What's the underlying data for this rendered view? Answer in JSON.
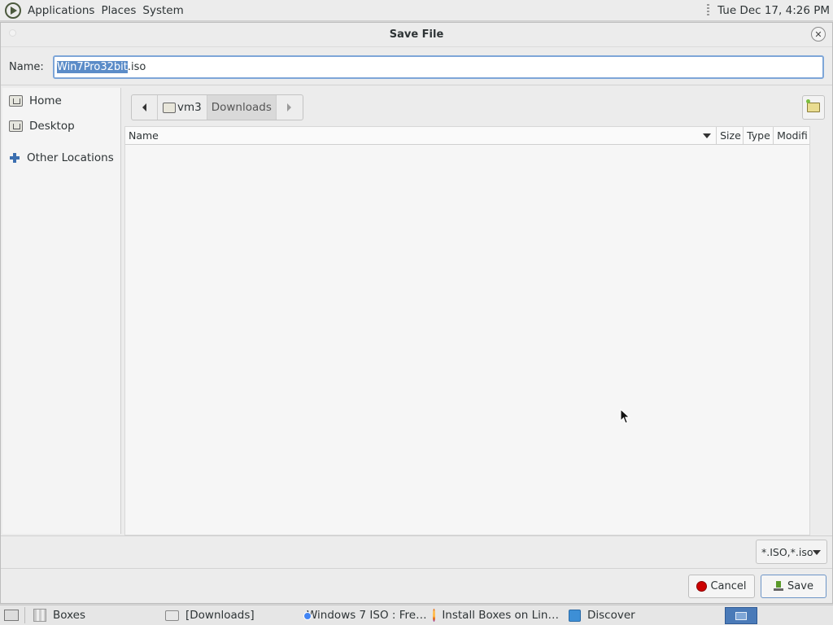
{
  "top_panel": {
    "menu": [
      "Applications",
      "Places",
      "System"
    ],
    "clock": "Tue Dec 17,  4:26 PM"
  },
  "dialog": {
    "title": "Save File",
    "name_label": "Name:",
    "filename_selected": "Win7Pro32bit",
    "filename_rest": ".iso",
    "sidebar": [
      {
        "label": "Home",
        "icon": "home-folder-icon"
      },
      {
        "label": "Desktop",
        "icon": "desktop-folder-icon"
      },
      {
        "label": "Other Locations",
        "icon": "plus-icon"
      }
    ],
    "pathbar": {
      "segments": [
        "vm3",
        "Downloads"
      ]
    },
    "columns": [
      "Name",
      "Size",
      "Type",
      "Modifi"
    ],
    "filter_label": "*.ISO,*.iso",
    "cancel_label": "Cancel",
    "save_label": "Save"
  },
  "taskbar": {
    "tasks": [
      {
        "label": "Boxes",
        "icon": "boxes-icon"
      },
      {
        "label": "[Downloads]",
        "icon": "folder-icon"
      },
      {
        "label": "Windows 7 ISO : Fre…",
        "icon": "chrome-icon"
      },
      {
        "label": "Install Boxes on Lin…",
        "icon": "firefox-icon"
      },
      {
        "label": "Discover",
        "icon": "discover-icon"
      }
    ]
  },
  "colors": {
    "selection": "#5b8cc8",
    "cancel_red": "#cc0000",
    "workspace_active": "#4a7ab8"
  }
}
